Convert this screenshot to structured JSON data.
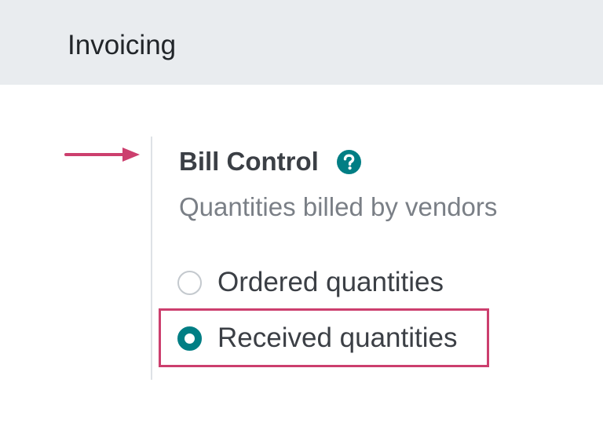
{
  "section": {
    "title": "Invoicing"
  },
  "setting": {
    "title": "Bill Control",
    "description": "Quantities billed by vendors",
    "options": [
      {
        "label": "Ordered quantities",
        "selected": false
      },
      {
        "label": "Received quantities",
        "selected": true
      }
    ]
  },
  "colors": {
    "header_bg": "#e9ecef",
    "accent": "#017e84",
    "annotation": "#cc3f6e"
  },
  "icons": {
    "help": "question-circle-icon",
    "annotation_arrow": "arrow-right-icon"
  }
}
